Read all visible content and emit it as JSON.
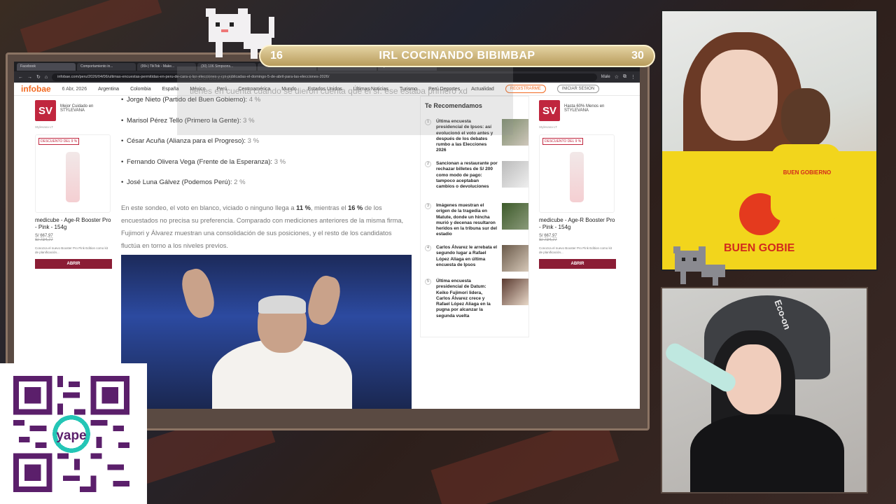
{
  "overlay_banner": {
    "left_count": "16",
    "title": "IRL COCINANDO BIBIMBAP",
    "right_count": "30"
  },
  "browser": {
    "tabs": [
      "Facebook",
      "Comportamiento in...",
      "(99+) TikTok - Make...",
      "(30) 106 Simpsons...",
      "",
      "",
      "Ejecutivo de la..."
    ],
    "url": "infobae.com/peru/2026/04/06/ultimas-encuestas-permitidas-en-peru-de-cara-a-las-elecciones-y-cpi-publicadas-el-domingo-5-de-abril-para-las-elecciones-2026/",
    "profile": "Male"
  },
  "site": {
    "logo": "infobae",
    "date": "6 Abr, 2026",
    "nav": [
      "Argentina",
      "Colombia",
      "España",
      "México",
      "Perú",
      "Centroamérica",
      "Mundo",
      "Estados Unidos",
      "Últimas Noticias",
      "Turismo",
      "Perú Deportes",
      "Actualidad"
    ],
    "register": "REGISTRARME",
    "login": "INICIAR SESION"
  },
  "ad_left": {
    "logo": "SV",
    "brand_text": "Mejor Cuidado en STYLEVANA",
    "small": "Stylevana LT",
    "badge": "DESCUENTO DEL 9 %",
    "product": "medicube - Age-R Booster Pro - Pink - 154g",
    "price": "S/ 667,97",
    "old_price": "S/ 734,77",
    "desc": "Conozca el nuevo Booster Pro Pink Edition como kit de planificación...",
    "cta": "ABRIR"
  },
  "ad_right": {
    "logo": "SV",
    "brand_text": "Hasta 60% Menos en STYLEVANA",
    "small": "Stylevana LT",
    "badge": "DESCUENTO DEL 9 %",
    "product": "medicube - Age-R Booster Pro - Pink - 154g",
    "price": "S/ 667,97",
    "old_price": "S/ 734,77",
    "desc": "Conozca el nuevo Booster Pro Pink Edition como kit de planificación...",
    "cta": "ABRIR"
  },
  "article": {
    "bullets": [
      {
        "name": "Jorge Nieto (Partido del Buen Gobierno):",
        "pct": "4 %"
      },
      {
        "name": "Marisol Pérez Tello (Primero la Gente):",
        "pct": "3 %"
      },
      {
        "name": "César Acuña (Alianza para el Progreso):",
        "pct": "3 %"
      },
      {
        "name": "Fernando Olivera Vega (Frente de la Esperanza):",
        "pct": "3 %"
      },
      {
        "name": "José Luna Gálvez (Podemos Perú):",
        "pct": "2 %"
      }
    ],
    "para_a": "En este sondeo, el voto en blanco, viciado o ninguno llega a ",
    "pct_a": "11 %",
    "para_b": ", mientras el ",
    "pct_b": "16 %",
    "para_c": " de los encuestados no precisa su preferencia. Comparado con mediciones anteriores de la misma firma, Fujimori y Álvarez muestran una consolidación de sus posiciones, y el resto de los candidatos fluctúa en torno a los niveles previos."
  },
  "recommended": {
    "heading": "Te Recomendamos",
    "items": [
      {
        "num": "1",
        "title": "Última encuesta presidencial de Ipsos: así evolucionó el voto antes y después de los debates rumbo a las Elecciones 2026"
      },
      {
        "num": "2",
        "title": "Sancionan a restaurante por rechazar billetes de S/ 200 como modo de pago: tampoco aceptaban cambios o devoluciones"
      },
      {
        "num": "3",
        "title": "Imágenes muestran el origen de la tragedia en Matute, donde un hincha murió y decenas resultaron heridos en la tribuna sur del estadio"
      },
      {
        "num": "4",
        "title": "Carlos Álvarez le arrebata el segundo lugar a Rafael López Aliaga en última encuesta de Ipsos"
      },
      {
        "num": "5",
        "title": "Última encuesta presidencial de Datum: Keiko Fujimori lidera, Carlos Álvarez crece y Rafael López Aliaga en la pugna por alcanzar la segunda vuelta"
      }
    ]
  },
  "chat_overlay": {
    "user": "LeCorbusier3",
    "message": "tienes en cuenta cuando se dieron cuenta que el sr. ese estaba primero xd"
  },
  "cam1": {
    "slogan": "BUEN GOBIERNO",
    "big_text": "BUEN GOBIE"
  },
  "cam2": {
    "logo": "Eco-on"
  },
  "qr": {
    "label": "yape"
  }
}
